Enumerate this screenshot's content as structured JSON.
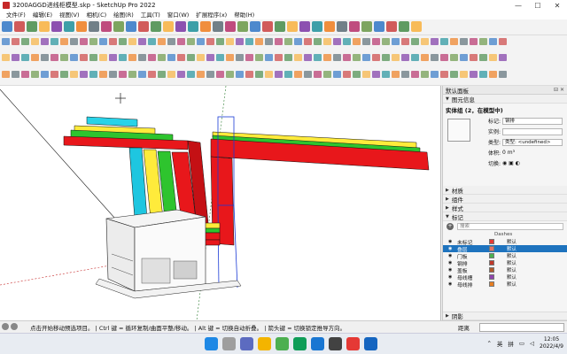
{
  "window": {
    "title": "3200AGGD进线柜模型.skp - SketchUp Pro 2022",
    "controls": [
      "—",
      "☐",
      "✕"
    ]
  },
  "menu": [
    "文件(F)",
    "编辑(E)",
    "视图(V)",
    "相机(C)",
    "绘图(R)",
    "工具(T)",
    "窗口(W)",
    "扩展程序(x)",
    "帮助(H)"
  ],
  "tray": {
    "title": "默认面板",
    "entity_info": {
      "section": "图元信息",
      "heading": "实体组 (2，在模型中)",
      "tag_label": "标记:",
      "tag_value": "钢排",
      "instance_label": "实例:",
      "instance_value": "",
      "type_label": "类型:",
      "type_value": "类型: <undefined>",
      "cut_label": "切换:",
      "volume_label": "体积:",
      "volume_value": "0 m³"
    },
    "collapsed_panels": [
      "材质",
      "组件",
      "样式"
    ],
    "tags": {
      "section": "标记",
      "search_placeholder": "搜索",
      "column_dashes": "Dashes",
      "rows": [
        {
          "name": "未标记",
          "color": "#e53935",
          "dash": "默认",
          "selected": false
        },
        {
          "name": "叠层",
          "color": "#e57368",
          "dash": "默认",
          "selected": true
        },
        {
          "name": "门板",
          "color": "#4caf50",
          "dash": "默认",
          "selected": false
        },
        {
          "name": "钢排",
          "color": "#c0392b",
          "dash": "默认",
          "selected": false
        },
        {
          "name": "盖板",
          "color": "#b05a2c",
          "dash": "默认",
          "selected": false
        },
        {
          "name": "母线槽",
          "color": "#8e44ad",
          "dash": "默认",
          "selected": false
        },
        {
          "name": "母线排",
          "color": "#e67e22",
          "dash": "默认",
          "selected": false
        }
      ]
    },
    "bottom_panel": "阴影"
  },
  "status": {
    "message": "点击开始移动预选项目。 | Ctrl 键 = 循环复制/曲面平整/移动。 | Alt 键 = 切换自动折叠。 | 箭头键 = 切换锁定推导方向。",
    "distance_label": "距离"
  },
  "taskbar": {
    "ime": [
      "英",
      "拼"
    ],
    "time": "12:05",
    "date": "2022/4/9"
  }
}
